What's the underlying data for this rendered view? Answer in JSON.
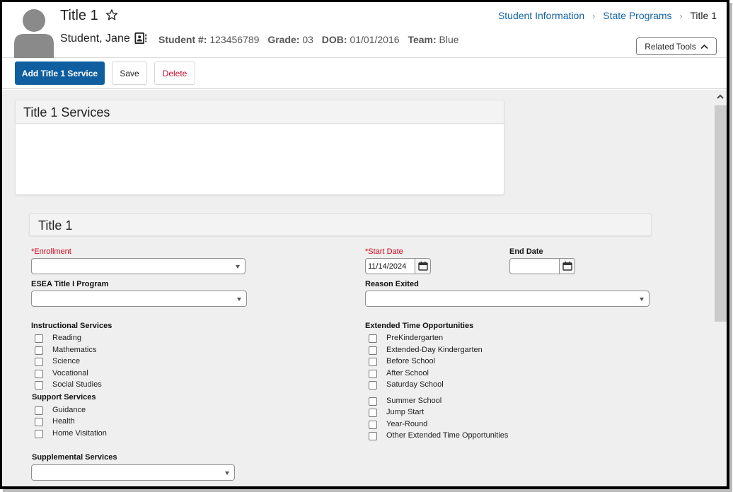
{
  "header": {
    "title": "Title 1",
    "student_name": "Student, Jane",
    "meta": [
      {
        "label": "Student #:",
        "value": "123456789"
      },
      {
        "label": "Grade:",
        "value": "03"
      },
      {
        "label": "DOB:",
        "value": "01/01/2016"
      },
      {
        "label": "Team:",
        "value": "Blue"
      }
    ],
    "breadcrumb": [
      {
        "label": "Student Information",
        "link": true
      },
      {
        "label": "State Programs",
        "link": true
      },
      {
        "label": "Title 1",
        "link": false
      }
    ],
    "breadcrumb_separator": ">",
    "related_tools_label": "Related Tools"
  },
  "toolbar": {
    "add_label": "Add Title 1 Service",
    "save_label": "Save",
    "delete_label": "Delete"
  },
  "services_panel": {
    "title": "Title 1 Services"
  },
  "form": {
    "section_title": "Title 1",
    "enrollment": {
      "label": "*Enrollment",
      "value": ""
    },
    "start_date": {
      "label": "*Start Date",
      "value": "11/14/2024"
    },
    "end_date": {
      "label": "End Date",
      "value": ""
    },
    "esea_program": {
      "label": "ESEA Title I Program",
      "value": ""
    },
    "reason_exited": {
      "label": "Reason Exited",
      "value": ""
    },
    "instructional_services": {
      "title": "Instructional Services",
      "items": [
        "Reading",
        "Mathematics",
        "Science",
        "Vocational",
        "Social Studies"
      ]
    },
    "support_services": {
      "title": "Support Services",
      "items": [
        "Guidance",
        "Health",
        "Home Visitation"
      ]
    },
    "extended_time": {
      "title": "Extended Time Opportunities",
      "items": [
        "PreKindergarten",
        "Extended-Day Kindergarten",
        "Before School",
        "After School",
        "Saturday School",
        "Summer School",
        "Jump Start",
        "Year-Round",
        "Other Extended Time Opportunities"
      ]
    },
    "supplemental_services": {
      "label": "Supplemental Services",
      "value": ""
    }
  },
  "colors": {
    "primary": "#0f5fa0",
    "link": "#1464a6",
    "required": "#d0021b",
    "delete": "#c8102e"
  }
}
